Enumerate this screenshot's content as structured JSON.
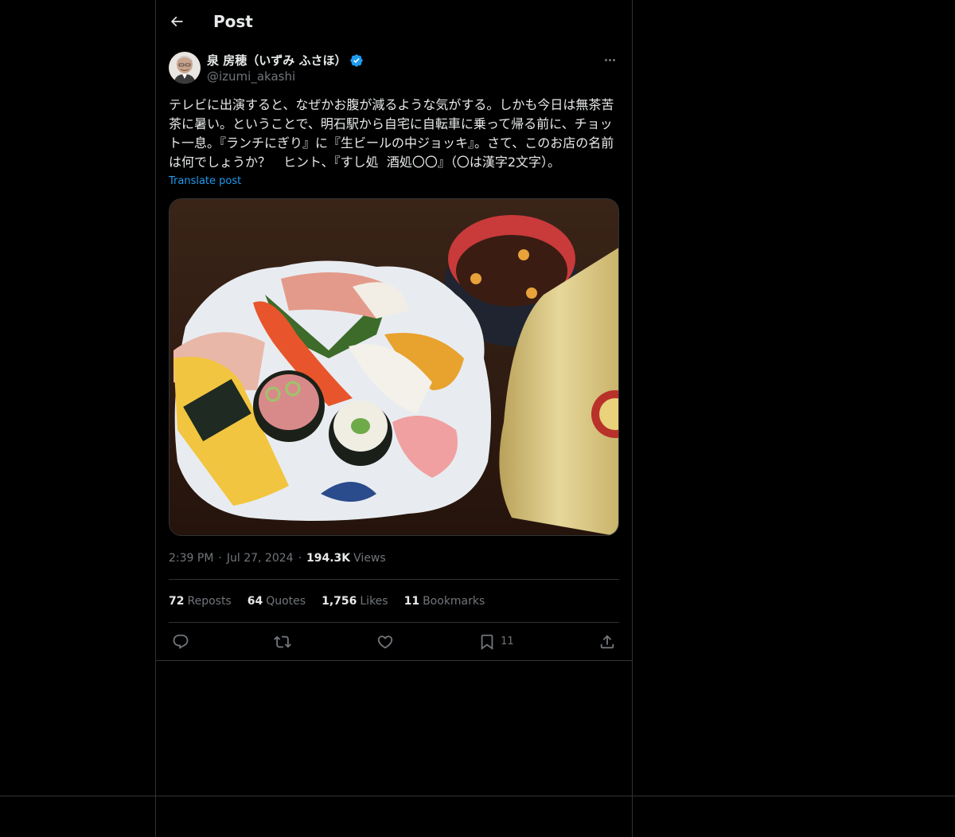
{
  "header": {
    "title": "Post",
    "back_icon": "arrow-left-icon"
  },
  "author": {
    "name": "泉 房穂（いずみ ふさほ）",
    "handle": "@izumi_akashi",
    "verified_color": "#1d9bf0"
  },
  "post": {
    "text": "テレビに出演すると、なぜかお腹が減るような気がする。しかも今日は無茶苦茶に暑い。ということで、明石駅から自宅に自転車に乗って帰る前に、チョット一息。『ランチにぎり』に『生ビールの中ジョッキ』。さて、このお店の名前は何でしょうか？　ヒント、『すし処  酒処〇〇』（〇は漢字2文字）。",
    "translate_label": "Translate post"
  },
  "meta": {
    "time": "2:39 PM",
    "separator": "·",
    "date": "Jul 27, 2024",
    "views_count": "194.3K",
    "views_label": "Views"
  },
  "stats": [
    {
      "count": "72",
      "label": "Reposts"
    },
    {
      "count": "64",
      "label": "Quotes"
    },
    {
      "count": "1,756",
      "label": "Likes"
    },
    {
      "count": "11",
      "label": "Bookmarks"
    }
  ],
  "actions": {
    "reply_icon": "reply-icon",
    "repost_icon": "repost-icon",
    "like_icon": "heart-icon",
    "bookmark_icon": "bookmark-icon",
    "bookmark_count": "11",
    "share_icon": "share-icon"
  },
  "colors": {
    "background": "#000000",
    "accent": "#1d9bf0",
    "muted": "#71767b",
    "border": "#2f3336"
  }
}
